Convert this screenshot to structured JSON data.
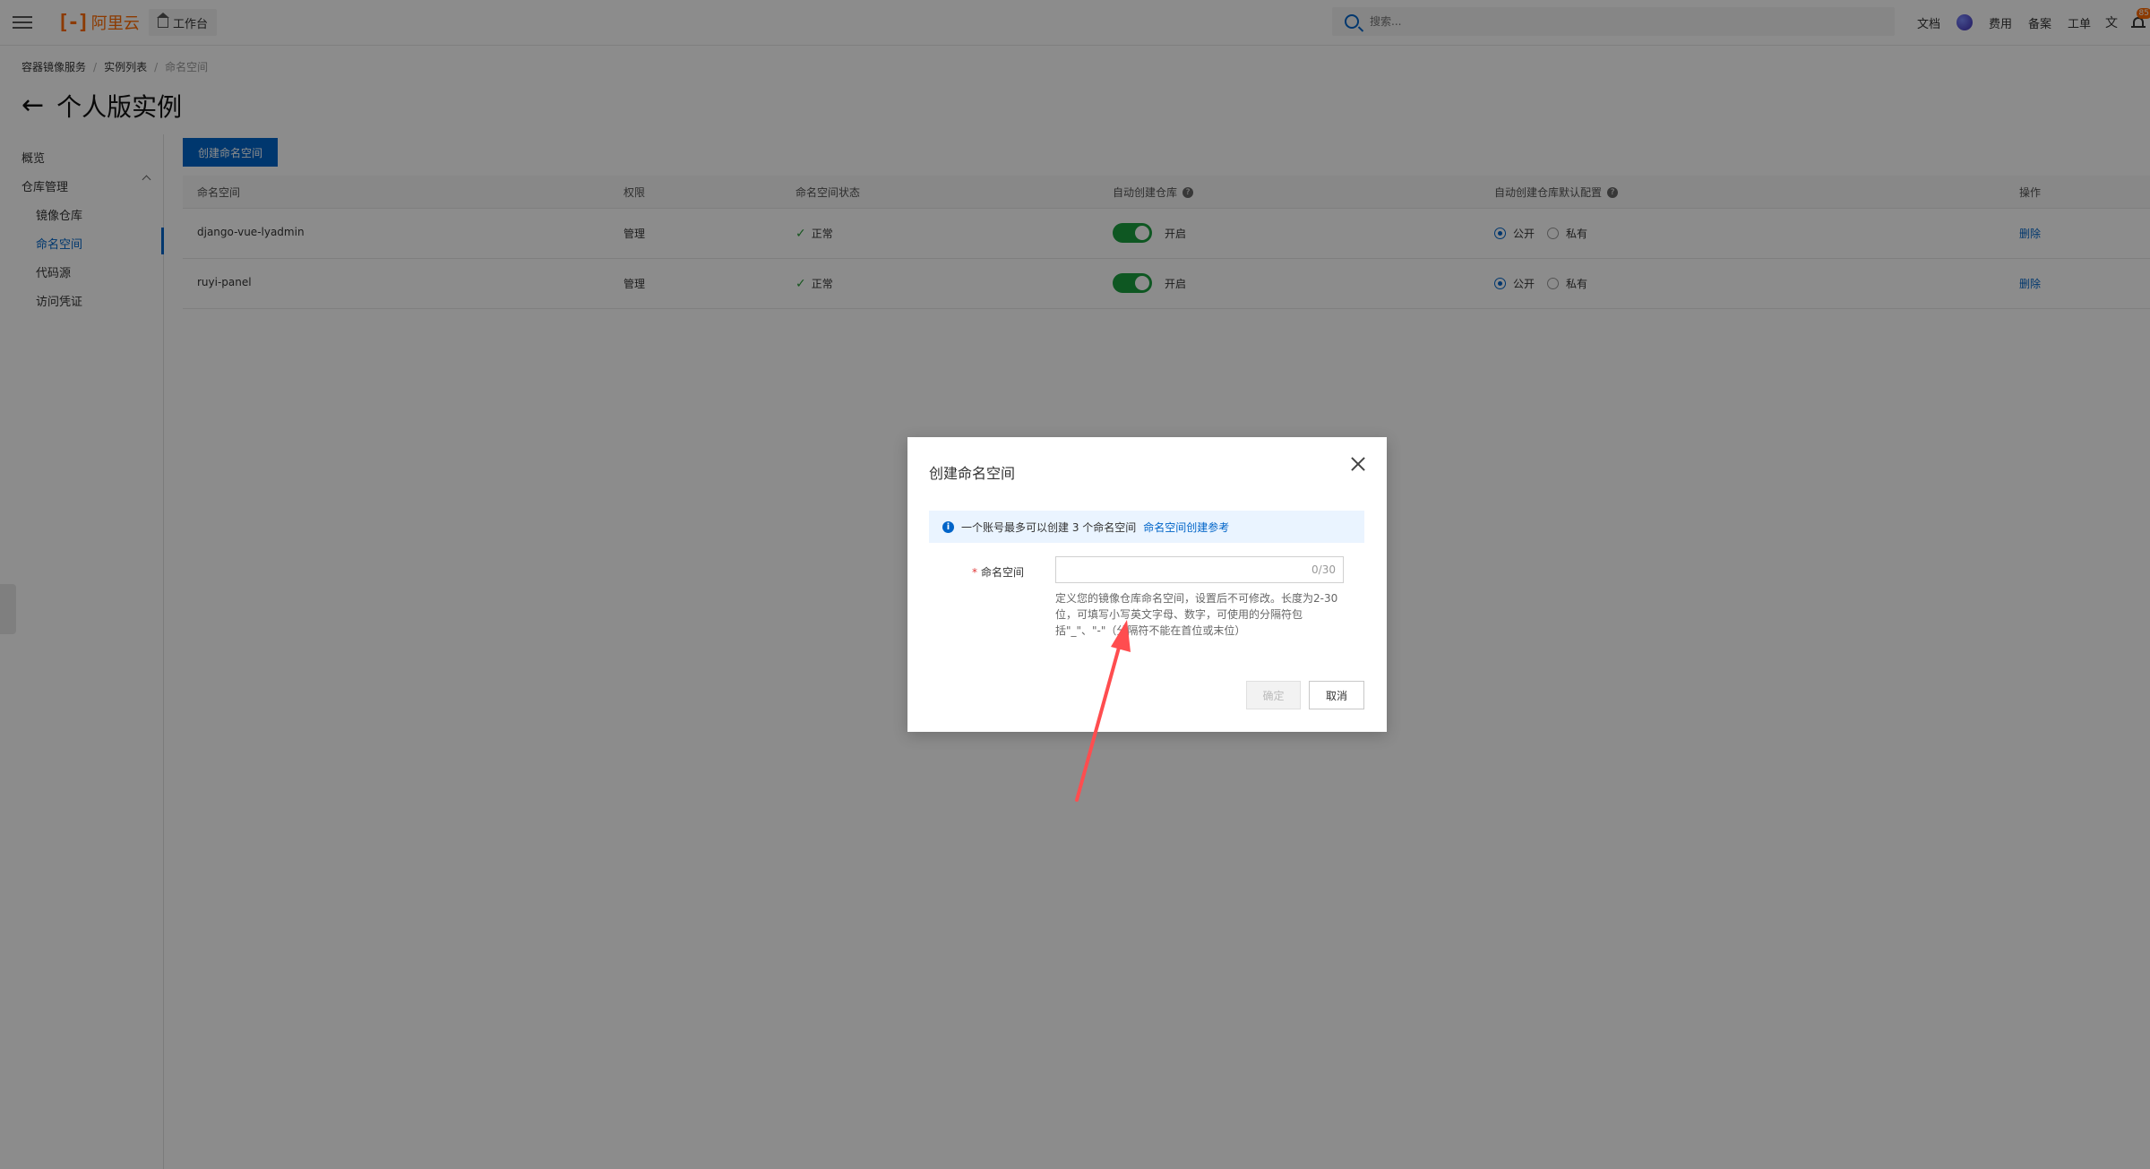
{
  "topbar": {
    "logo_mark": "[-]",
    "logo_text": "阿里云",
    "workbench": "工作台",
    "search_placeholder": "搜索...",
    "links": [
      "文档",
      "费用",
      "备案",
      "工单"
    ],
    "translate_icon": "文",
    "notification_count": "85"
  },
  "breadcrumb": [
    "容器镜像服务",
    "实例列表",
    "命名空间"
  ],
  "page_title": "个人版实例",
  "sidebar": {
    "overview": "概览",
    "repo_mgmt": "仓库管理",
    "items": [
      "镜像仓库",
      "命名空间",
      "代码源",
      "访问凭证"
    ]
  },
  "create_button": "创建命名空间",
  "table": {
    "headers": [
      "命名空间",
      "权限",
      "命名空间状态",
      "自动创建仓库",
      "自动创建仓库默认配置",
      "操作"
    ],
    "rows": [
      {
        "name": "django-vue-lyadmin",
        "perm": "管理",
        "status": "正常",
        "auto": "开启",
        "public": "公开",
        "private": "私有",
        "action": "删除"
      },
      {
        "name": "ruyi-panel",
        "perm": "管理",
        "status": "正常",
        "auto": "开启",
        "public": "公开",
        "private": "私有",
        "action": "删除"
      }
    ]
  },
  "dialog": {
    "title": "创建命名空间",
    "notice": "一个账号最多可以创建 3 个命名空间",
    "notice_link": "命名空间创建参考",
    "field_label": "命名空间",
    "required_mark": "*",
    "input_value": "",
    "char_count": "0/30",
    "hint": "定义您的镜像仓库命名空间，设置后不可修改。长度为2-30位，可填写小写英文字母、数字，可使用的分隔符包括\"_\"、\"-\"（分隔符不能在首位或末位）",
    "ok": "确定",
    "cancel": "取消"
  },
  "colors": {
    "accent": "#0064c8",
    "brand": "#ff6a00",
    "switch_on": "#1b9e3e",
    "annotation_arrow": "#ff4d4f"
  }
}
